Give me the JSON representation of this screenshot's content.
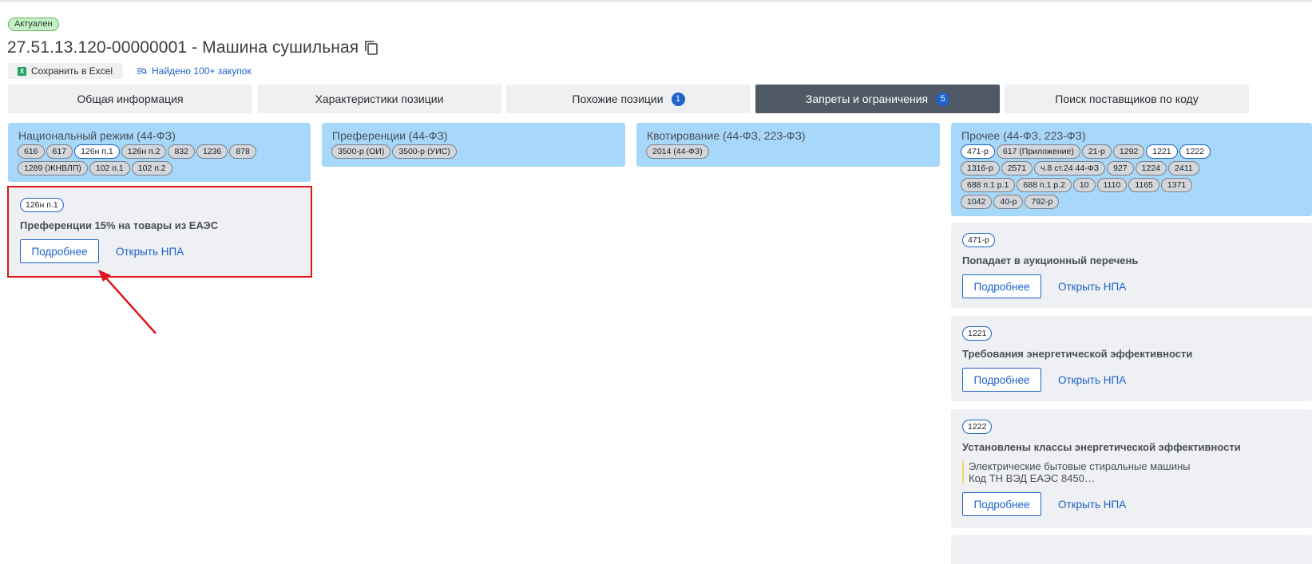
{
  "status": "Актуален",
  "title": "27.51.13.120-00000001 - Машина сушильная",
  "toolbar": {
    "excel_label": "Сохранить в Excel",
    "found_label": "Найдено 100+ закупок"
  },
  "tabs": [
    {
      "label": "Общая информация",
      "count": null,
      "active": false
    },
    {
      "label": "Характеристики позиции",
      "count": null,
      "active": false
    },
    {
      "label": "Похожие позиции",
      "count": "1",
      "active": false
    },
    {
      "label": "Запреты и ограничения",
      "count": "5",
      "active": true
    },
    {
      "label": "Поиск поставщиков по коду",
      "count": null,
      "active": false
    }
  ],
  "categories": [
    {
      "title": "Национальный режим (44-ФЗ)",
      "chips": [
        "616",
        "617",
        "126н п.1",
        "126н п.2",
        "832",
        "1236",
        "878",
        "1289 (ЖНВЛП)",
        "102 п.1",
        "102 п.2"
      ],
      "active_chip": "126н п.1"
    },
    {
      "title": "Преференции (44-ФЗ)",
      "chips": [
        "3500-р (ОИ)",
        "3500-р (УИС)"
      ],
      "active_chip": null
    },
    {
      "title": "Квотирование (44-ФЗ, 223-ФЗ)",
      "chips": [
        "2014 (44-ФЗ)"
      ],
      "active_chip": null
    },
    {
      "title": "Прочее (44-ФЗ, 223-ФЗ)",
      "chips": [
        "471-р",
        "617 (Приложение)",
        "21-р",
        "1292",
        "1221",
        "1222",
        "1316-р",
        "2571",
        "ч.8 ст.24 44-ФЗ",
        "927",
        "1224",
        "2411",
        "688 п.1 р.1",
        "688 п.1 р.2",
        "10",
        "1110",
        "1165",
        "1371",
        "1042",
        "40-р",
        "792-р"
      ],
      "active_chip_list": [
        "471-р",
        "1221",
        "1222"
      ]
    }
  ],
  "cards": [
    {
      "badge": "126н п.1",
      "title": "Преференции 15% на товары из ЕАЭС",
      "note": null
    },
    {
      "badge": "471-р",
      "title": "Попадает в аукционный перечень",
      "note": null
    },
    {
      "badge": "1221",
      "title": "Требования энергетической эффективности",
      "note": null
    },
    {
      "badge": "1222",
      "title": "Установлены классы энергетической эффективности",
      "note": [
        "Электрические бытовые стиральные машины",
        "Код ТН ВЭД ЕАЭС 8450…"
      ]
    }
  ],
  "actions": {
    "more": "Подробнее",
    "npa": "Открыть НПА"
  },
  "colors": {
    "active_tab": "#4f5a66",
    "accent": "#1e63c9",
    "category_bg": "#a7d8fb",
    "highlight": "#e0141c"
  },
  "icons": [
    "copy-icon",
    "excel-icon",
    "list-search-icon",
    "arrow-annotation"
  ]
}
